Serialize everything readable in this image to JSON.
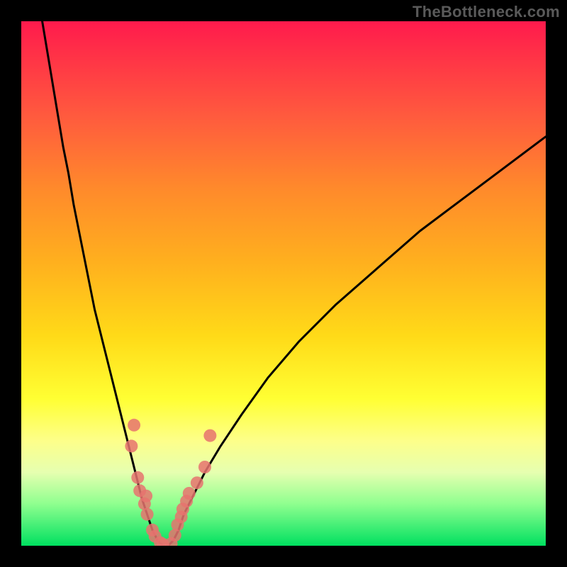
{
  "watermark": "TheBottleneck.com",
  "chart_data": {
    "type": "line",
    "title": "",
    "xlabel": "",
    "ylabel": "",
    "xlim": [
      0,
      100
    ],
    "ylim": [
      0,
      100
    ],
    "grid": false,
    "background_gradient": {
      "direction": "vertical",
      "stops": [
        {
          "pos": 0.0,
          "color": "#ff1a4d"
        },
        {
          "pos": 0.18,
          "color": "#ff5a3e"
        },
        {
          "pos": 0.46,
          "color": "#ffb01e"
        },
        {
          "pos": 0.72,
          "color": "#ffff33"
        },
        {
          "pos": 0.86,
          "color": "#e6ffb0"
        },
        {
          "pos": 1.0,
          "color": "#00e060"
        }
      ]
    },
    "series": [
      {
        "name": "bottleneck-curve",
        "color": "#000000",
        "x": [
          4,
          5,
          6,
          7,
          8,
          9,
          10,
          11,
          12,
          13,
          14,
          15,
          16,
          17,
          18,
          19,
          20,
          21,
          22,
          23,
          24,
          25,
          26,
          27,
          28,
          29,
          30,
          31,
          33,
          35,
          38,
          42,
          47,
          53,
          60,
          68,
          76,
          84,
          92,
          100
        ],
        "y": [
          100,
          94,
          88,
          82,
          76,
          71,
          65,
          60,
          55,
          50,
          45,
          41,
          37,
          33,
          29,
          25,
          21,
          17,
          13,
          9,
          6,
          3,
          1,
          0,
          0,
          1,
          3,
          6,
          10,
          14,
          19,
          25,
          32,
          39,
          46,
          53,
          60,
          66,
          72,
          78
        ]
      }
    ],
    "scatter": [
      {
        "name": "sample-points",
        "color": "#e6736f",
        "radius": 9,
        "points": [
          {
            "x": 21.0,
            "y": 19.0
          },
          {
            "x": 21.5,
            "y": 23.0
          },
          {
            "x": 22.2,
            "y": 13.0
          },
          {
            "x": 22.6,
            "y": 10.5
          },
          {
            "x": 23.5,
            "y": 8.0
          },
          {
            "x": 23.8,
            "y": 9.5
          },
          {
            "x": 24.0,
            "y": 6.0
          },
          {
            "x": 25.0,
            "y": 3.0
          },
          {
            "x": 25.5,
            "y": 1.8
          },
          {
            "x": 26.5,
            "y": 0.6
          },
          {
            "x": 27.0,
            "y": 0.3
          },
          {
            "x": 28.6,
            "y": 0.4
          },
          {
            "x": 29.3,
            "y": 2.0
          },
          {
            "x": 29.8,
            "y": 4.0
          },
          {
            "x": 30.5,
            "y": 5.5
          },
          {
            "x": 30.8,
            "y": 7.0
          },
          {
            "x": 31.5,
            "y": 8.5
          },
          {
            "x": 32.0,
            "y": 10.0
          },
          {
            "x": 33.5,
            "y": 12.0
          },
          {
            "x": 35.0,
            "y": 15.0
          },
          {
            "x": 36.0,
            "y": 21.0
          }
        ]
      }
    ]
  }
}
